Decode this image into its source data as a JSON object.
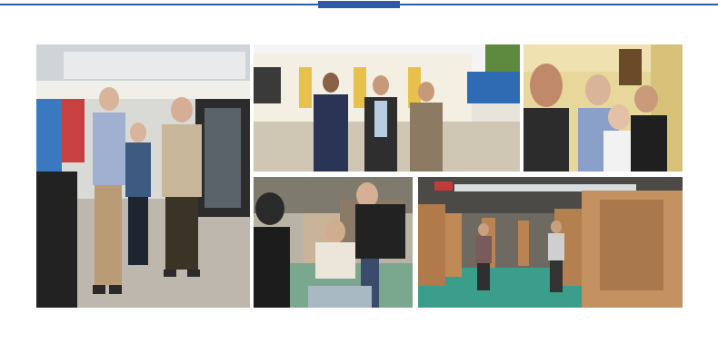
{
  "colors": {
    "accent": "#2f5aa8",
    "background": "#ffffff"
  },
  "photos": [
    {
      "name": "airport-group-photo",
      "description_icon": "photo-icon"
    },
    {
      "name": "factory-yard-group-photo",
      "description_icon": "photo-icon"
    },
    {
      "name": "office-selfie-photo",
      "description_icon": "photo-icon"
    },
    {
      "name": "product-inspection-photo",
      "description_icon": "photo-icon"
    },
    {
      "name": "workshop-partitions-photo",
      "description_icon": "photo-icon"
    }
  ]
}
